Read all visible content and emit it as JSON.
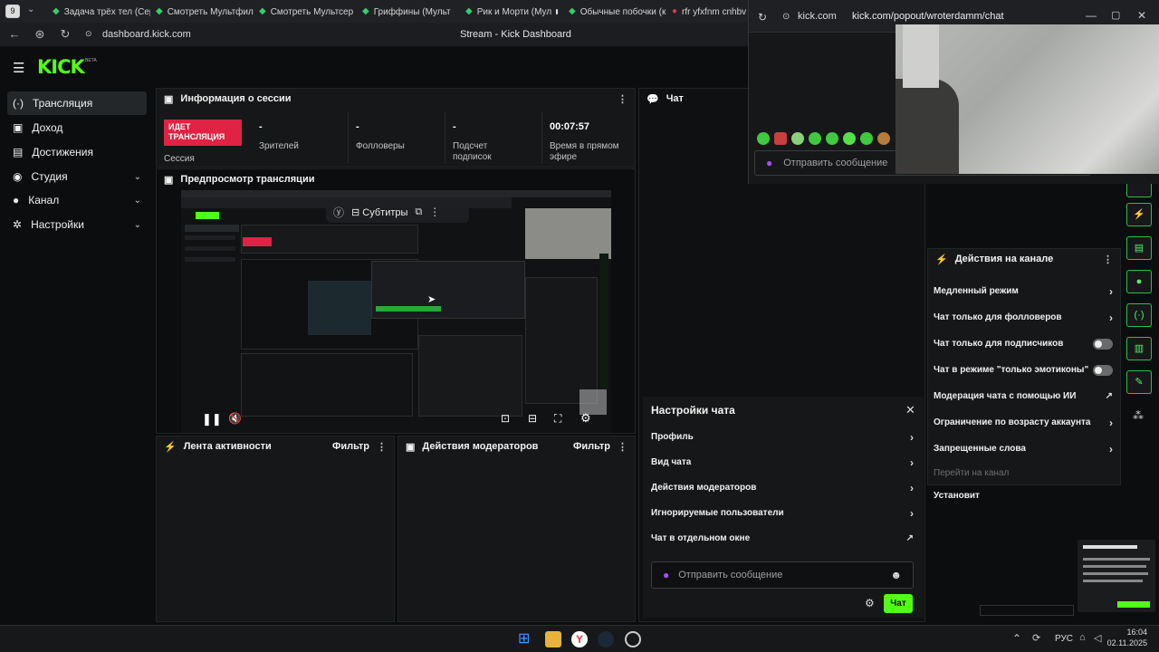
{
  "browser": {
    "tab_count": "9",
    "tabs": [
      {
        "label": "Задача трёх тел (Сер"
      },
      {
        "label": "Смотреть Мультфил"
      },
      {
        "label": "Смотреть Мультсер"
      },
      {
        "label": "Гриффины (Мульт"
      },
      {
        "label": "Рик и Морти (Мул"
      },
      {
        "label": "Обычные побочки (к"
      },
      {
        "label": "rfr yfxfnm cnhbv"
      }
    ],
    "url": "dashboard.kick.com",
    "page_title": "Stream - Kick Dashboard"
  },
  "popout": {
    "site": "kick.com",
    "url": "kick.com/popout/wroterdamm/chat",
    "input_placeholder": "Отправить сообщение"
  },
  "brand": {
    "logo": "KICK",
    "badge": "BETA"
  },
  "sidebar": {
    "items": [
      {
        "label": "Трансляция",
        "icon": "broadcast-icon"
      },
      {
        "label": "Доход",
        "icon": "wallet-icon"
      },
      {
        "label": "Достижения",
        "icon": "trophy-icon"
      },
      {
        "label": "Студия",
        "icon": "palette-icon"
      },
      {
        "label": "Канал",
        "icon": "user-icon"
      },
      {
        "label": "Настройки",
        "icon": "gear-icon"
      }
    ]
  },
  "session": {
    "title": "Информация о сессии",
    "live_badge": "ИДЕТ ТРАНСЛЯЦИЯ",
    "session_label": "Сессия",
    "stats": [
      {
        "value": "-",
        "label": "Зрителей"
      },
      {
        "value": "-",
        "label": "Фолловеры"
      },
      {
        "value": "-",
        "label": "Подсчет подписок"
      },
      {
        "value": "00:07:57",
        "label": "Время в прямом эфире"
      }
    ]
  },
  "preview": {
    "title": "Предпросмотр трансляции",
    "subtitles_label": "Субтитры"
  },
  "chat": {
    "title": "Чат",
    "settings_title": "Настройки чата",
    "settings_items": [
      {
        "label": "Профиль"
      },
      {
        "label": "Вид чата"
      },
      {
        "label": "Действия модераторов"
      },
      {
        "label": "Игнорируемые пользователи"
      },
      {
        "label": "Чат в отдельном окне"
      }
    ],
    "input_placeholder": "Отправить сообщение",
    "send_label": "Чат"
  },
  "activity": {
    "title": "Лента активности",
    "filter": "Фильтр"
  },
  "mod_actions": {
    "title": "Действия модераторов",
    "filter": "Фильтр"
  },
  "channel_actions": {
    "title": "Действия на канале",
    "items": [
      {
        "label": "Медленный режим",
        "control": "arrow"
      },
      {
        "label": "Чат только для фолловеров",
        "control": "arrow"
      },
      {
        "label": "Чат только для подписчиков",
        "control": "toggle"
      },
      {
        "label": "Чат в режиме \"только эмотиконы\"",
        "control": "toggle"
      },
      {
        "label": "Модерация чата с помощью ИИ",
        "control": "external"
      },
      {
        "label": "Ограничение по возрасту аккаунта",
        "control": "arrow"
      },
      {
        "label": "Запрещенные слова",
        "control": "arrow"
      }
    ],
    "goto_channel": "Перейти на канал",
    "install_label": "Установит"
  },
  "taskbar": {
    "lang": "РУС",
    "time": "16:04",
    "date": "02.11.2025"
  },
  "colors": {
    "accent": "#53fc18",
    "live": "#e02245",
    "panel": "#151718"
  }
}
